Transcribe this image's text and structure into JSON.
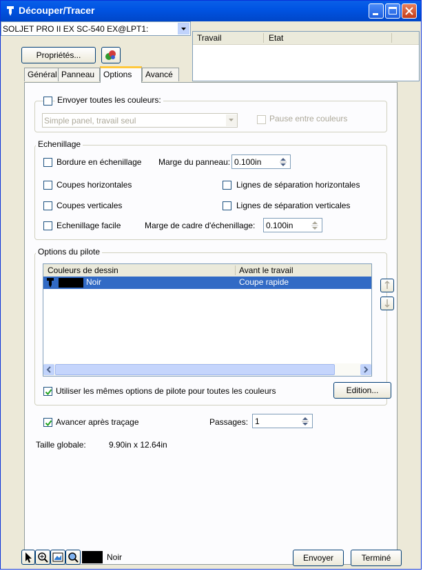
{
  "window": {
    "title": "Découper/Tracer"
  },
  "device": {
    "selected": "SOLJET PRO II EX SC-540 EX@LPT1:"
  },
  "properties_button": "Propriétés...",
  "jobs": {
    "columns": [
      "Travail",
      "Etat"
    ]
  },
  "tabs": [
    "Général",
    "Panneau",
    "Options",
    "Avancé"
  ],
  "colors_section": {
    "send_all_label": "Envoyer toutes les couleurs:",
    "mode_value": "Simple panel, travail seul",
    "pause_label": "Pause entre couleurs"
  },
  "weeding": {
    "title": "Echenillage",
    "border_label": "Bordure en échenillage",
    "panel_margin_label": "Marge du panneau:",
    "panel_margin_value": "0.100in",
    "h_cuts_label": "Coupes horizontales",
    "h_lines_label": "Lignes de séparation horizontales",
    "v_cuts_label": "Coupes verticales",
    "v_lines_label": "Lignes de séparation verticales",
    "easy_label": "Echenillage facile",
    "frame_margin_label": "Marge de cadre d'échenillage:",
    "frame_margin_value": "0.100in"
  },
  "driver": {
    "title": "Options du pilote",
    "col_colors": "Couleurs de dessin",
    "col_before": "Avant le travail",
    "rows": [
      {
        "swatch": "#000000",
        "name": "Noir",
        "before": "Coupe rapide"
      }
    ],
    "same_options_label": "Utiliser les mêmes options de pilote pour toutes les couleurs",
    "edit_button": "Edition..."
  },
  "advance": {
    "label": "Avancer après traçage",
    "passes_label": "Passages:",
    "passes_value": "1",
    "size_label": "Taille globale:",
    "size_value": "9.90in x 12.64in"
  },
  "footer": {
    "color_name": "Noir",
    "send_button": "Envoyer",
    "done_button": "Terminé"
  },
  "accent": "#316ac5"
}
